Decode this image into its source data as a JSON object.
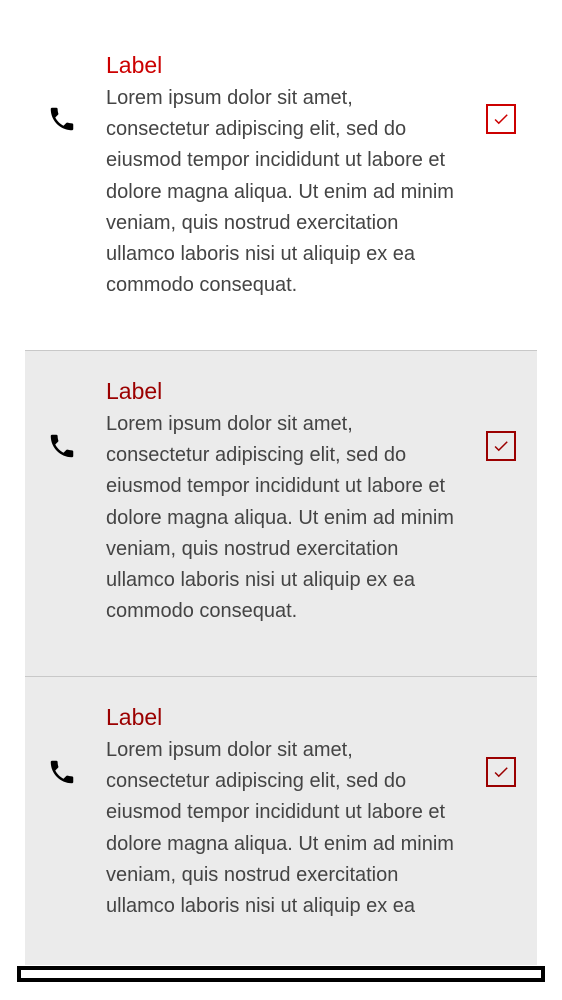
{
  "list": {
    "items": [
      {
        "label": "Label",
        "body": "Lorem ipsum dolor sit amet, consectetur adipiscing elit, sed do eiusmod tempor incididunt ut labore et dolore magna aliqua. Ut enim ad minim veniam, quis nostrud exercitation ullamco laboris nisi ut aliquip ex ea commodo consequat.",
        "leading_icon": "phone-icon",
        "checked": true
      },
      {
        "label": "Label",
        "body": "Lorem ipsum dolor sit amet, consectetur adipiscing elit, sed do eiusmod tempor incididunt ut labore et dolore magna aliqua. Ut enim ad minim veniam, quis nostrud exercitation ullamco laboris nisi ut aliquip ex ea commodo consequat.",
        "leading_icon": "phone-icon",
        "checked": true
      },
      {
        "label": "Label",
        "body": "Lorem ipsum dolor sit amet, consectetur adipiscing elit, sed do eiusmod tempor incididunt ut labore et dolore magna aliqua. Ut enim ad minim veniam, quis nostrud exercitation ullamco laboris nisi ut aliquip ex ea",
        "leading_icon": "phone-icon",
        "checked": true
      }
    ]
  },
  "colors": {
    "label_primary": "#cc0000",
    "label_shaded": "#9b0000",
    "body_text": "#444444",
    "item_shaded_bg": "#ebebeb",
    "divider": "#c8c8c8"
  }
}
